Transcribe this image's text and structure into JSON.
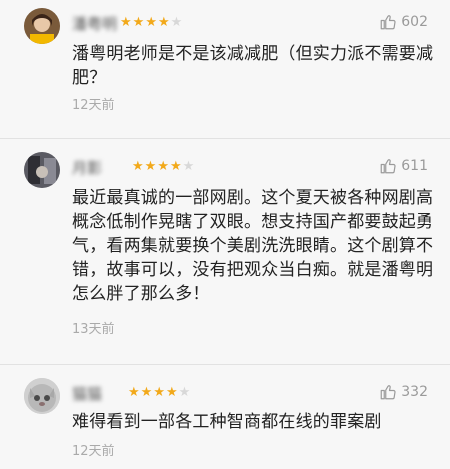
{
  "comments": [
    {
      "user": "潘粤明",
      "rating": 4,
      "likes": "602",
      "text": "潘粤明老师是不是该减减肥（但实力派不需要减肥？",
      "time": "12天前"
    },
    {
      "user": "月影",
      "rating": 4,
      "likes": "611",
      "text": "最近最真诚的一部网剧。这个夏天被各种网剧高概念低制作晃瞎了双眼。想支持国产都要鼓起勇气，看两集就要换个美剧洗洗眼睛。这个剧算不错，故事可以，没有把观众当白痴。就是潘粤明怎么胖了那么多！",
      "time": "13天前"
    },
    {
      "user": "猫猫",
      "rating": 4,
      "likes": "332",
      "text": "难得看到一部各工种智商都在线的罪案剧",
      "time": "12天前"
    }
  ],
  "colors": {
    "star_on": "#f2a91a",
    "star_off": "#d8d8d8",
    "muted": "#9a9a9a",
    "background": "#f7f7f7"
  },
  "icons": {
    "like": "thumbs-up-outline-icon"
  }
}
